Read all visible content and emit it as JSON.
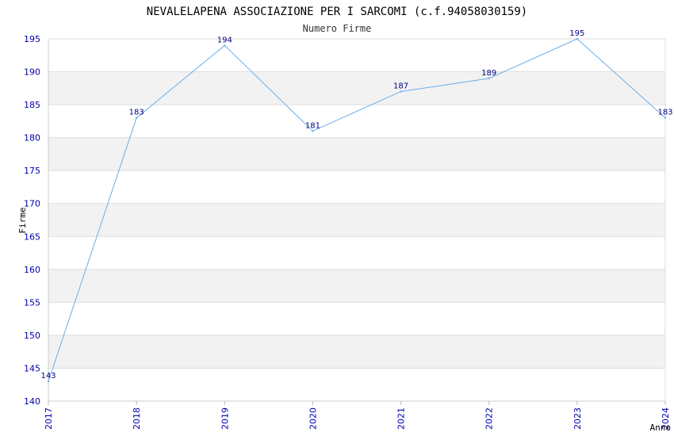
{
  "chart_data": {
    "type": "line",
    "title": "NEVALELAPENA ASSOCIAZIONE PER I SARCOMI (c.f.94058030159)",
    "subtitle": "Numero Firme",
    "xlabel": "Anno",
    "ylabel": "Firme",
    "x": [
      "2017",
      "2018",
      "2019",
      "2020",
      "2021",
      "2022",
      "2023",
      "2024"
    ],
    "series": [
      {
        "values": [
          143,
          183,
          194,
          181,
          187,
          189,
          195,
          183
        ]
      }
    ],
    "ylim": [
      140,
      195
    ],
    "yticks": [
      140,
      145,
      150,
      155,
      160,
      165,
      170,
      175,
      180,
      185,
      190,
      195
    ],
    "grid": true,
    "legend": "none",
    "colors": {
      "line": "#6aaeea",
      "band": "#f2f2f2",
      "grid": "#dddddd",
      "tick_text": "#0000aa",
      "data_label": "#000080"
    }
  }
}
